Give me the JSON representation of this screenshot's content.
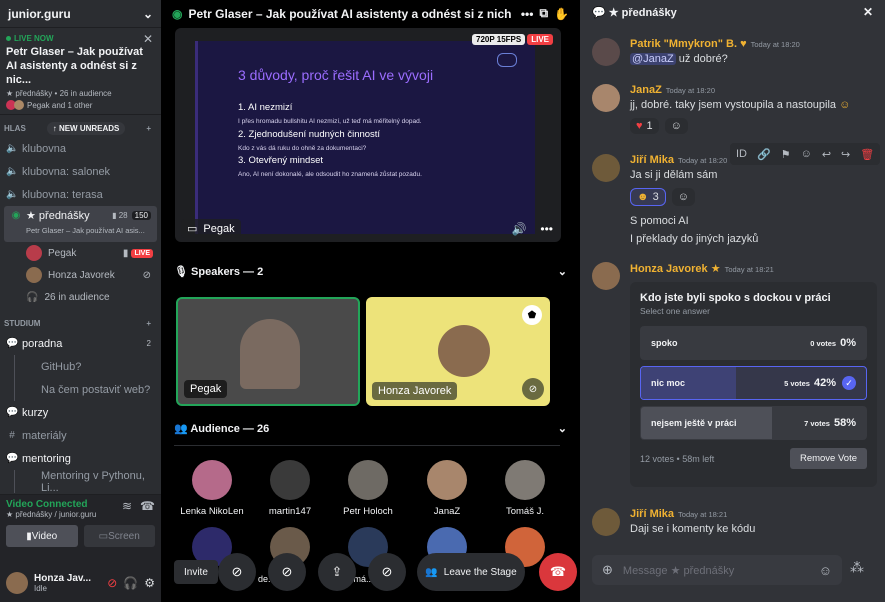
{
  "server": {
    "name": "junior.guru"
  },
  "live": {
    "label": "LIVE NOW",
    "title": "Petr Glaser – Jak používat AI asistenty a odnést si z nic...",
    "channel": "★ přednášky",
    "audience": "26 in audience",
    "who": "Pegak and 1 other"
  },
  "categories": {
    "hlas": "HLAS",
    "new_unreads": "NEW UNREADS",
    "studium": "STUDIUM"
  },
  "channels": [
    {
      "label": "klubovna"
    },
    {
      "label": "klubovna: salonek"
    },
    {
      "label": "klubovna: terasa"
    }
  ],
  "stage_channel": {
    "label": "★ přednášky",
    "count1": "28",
    "count2": "150",
    "sub": "Petr Glaser – Jak používat AI asis..."
  },
  "stage_users": [
    {
      "name": "Pegak",
      "badge": "LIVE"
    },
    {
      "name": "Honza Javorek"
    },
    {
      "name": "26 in audience"
    }
  ],
  "studium": [
    {
      "label": "poradna",
      "count": "2"
    },
    {
      "label": "kurzy"
    },
    {
      "label": "materiály"
    },
    {
      "label": "mentoring"
    }
  ],
  "threads": [
    "GitHub?",
    "Na čem postaviť web?",
    "Mentoring v Pythonu, Li..."
  ],
  "voice": {
    "status": "Video Connected",
    "where": "★ přednášky / junior.guru",
    "video": "Video",
    "screen": "Screen"
  },
  "user": {
    "name": "Honza Jav...",
    "status": "Idle"
  },
  "mid": {
    "title": "Petr Glaser – Jak používat AI asistenty a odnést si z nich ma",
    "quality": "720P 15FPS",
    "live": "LIVE",
    "slide": {
      "heading": "3 důvody, proč řešit AI ve vývoji",
      "items": [
        "1.  AI nezmizí",
        "2.  Zjednodušení nudných činností",
        "3.  Otevřený mindset"
      ],
      "notes": [
        "I přes hromadu bullshitu AI nezmizí, už teď má měřitelný dopad.",
        "Kdo z vás dá ruku do ohně za dokumentaci?",
        "Ano, AI není dokonalé, ale odsoudit ho znamená zůstat pozadu."
      ]
    },
    "streamer": "Pegak",
    "speakers_label": "Speakers — 2",
    "speaker_tiles": [
      "Pegak",
      "Honza Javorek"
    ],
    "audience_label": "Audience — 26",
    "audience": [
      "Lenka NikoLen",
      "martin147",
      "Petr Holoch",
      "JanaZ",
      "Tomáš J."
    ],
    "audience_row2": [
      "de...",
      "Tomá..."
    ],
    "invite": "Invite",
    "leave": "Leave the Stage"
  },
  "right": {
    "title": "★ přednášky",
    "messages": [
      {
        "name": "Patrik \"Mmykron\" B.",
        "time": "Today at 18:20",
        "mention": "@JanaZ",
        "text": " už dobré?",
        "color": "#f0b232"
      },
      {
        "name": "JanaZ",
        "time": "Today at 18:20",
        "text": "jj, dobré. taky jsem vystoupila a nastoupila",
        "reaction": "1",
        "color": "#f0b232"
      },
      {
        "name": "Jiří Mika",
        "time": "Today at 18:20",
        "text": "Ja si ji dělám  sám",
        "reaction": "3",
        "color": "#f0b232"
      },
      {
        "name": "Honza Javorek",
        "time": "Today at 18:21",
        "color": "#f0b232"
      },
      {
        "name": "Jiří Mika",
        "time": "Today at 18:21",
        "text": "Daji se i komenty ke kódu",
        "color": "#f0b232"
      }
    ],
    "extra_lines": [
      "S pomoci AI",
      "I  překlady do jiných jazyků"
    ],
    "poll": {
      "question": "Kdo jste byli spoko s dockou v práci",
      "hint": "Select one answer",
      "options": [
        {
          "label": "spoko",
          "votes": "0 votes",
          "pct": "0%",
          "frac": 0
        },
        {
          "label": "nic moc",
          "votes": "5 votes",
          "pct": "42%",
          "frac": 0.42,
          "selected": true
        },
        {
          "label": "nejsem ještě v práci",
          "votes": "7 votes",
          "pct": "58%",
          "frac": 0.58
        }
      ],
      "total": "12 votes",
      "left": "58m left",
      "remove": "Remove Vote"
    },
    "input_placeholder": "Message ★ přednášky"
  }
}
